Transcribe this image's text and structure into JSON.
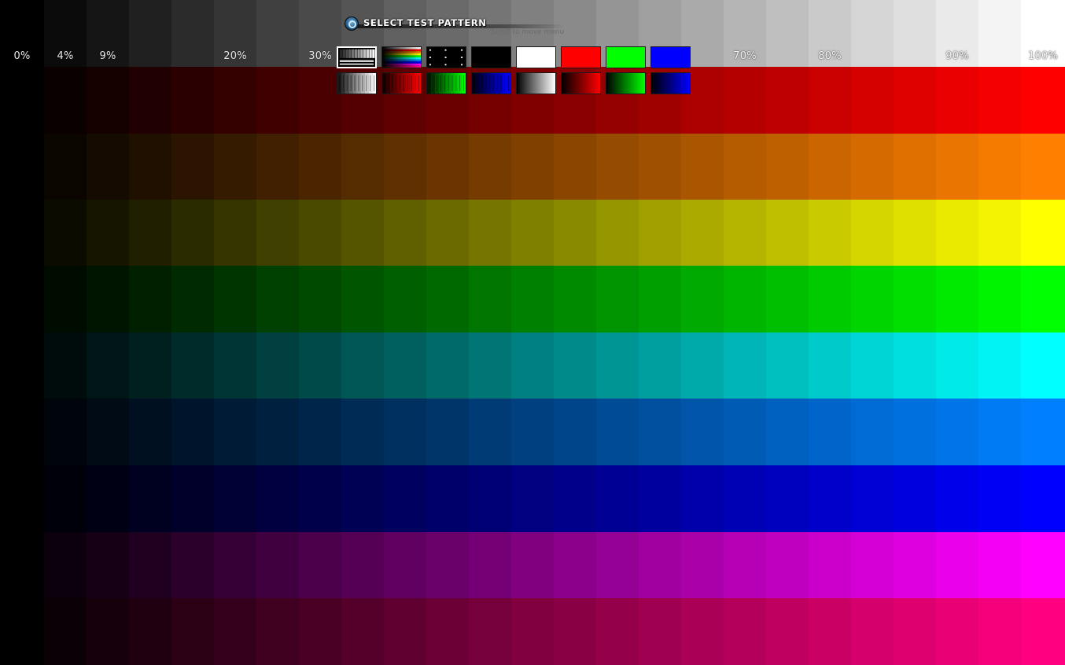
{
  "menu": {
    "title": "SELECT TEST PATTERN",
    "hint": "Scroll to move menu",
    "icon": "test-pattern-icon",
    "selected_index": 0,
    "thumbnails": [
      {
        "name": "grayscale-steps",
        "kind": "gray-steps"
      },
      {
        "name": "color-bars",
        "kind": "color-bars"
      },
      {
        "name": "dots",
        "kind": "dots"
      },
      {
        "name": "black",
        "kind": "solid",
        "color": "#000000"
      },
      {
        "name": "white",
        "kind": "solid",
        "color": "#ffffff"
      },
      {
        "name": "red",
        "kind": "solid",
        "color": "#ff0000"
      },
      {
        "name": "green",
        "kind": "solid",
        "color": "#00ff00"
      },
      {
        "name": "blue",
        "kind": "solid",
        "color": "#0000ff"
      },
      {
        "name": "gray-ramp-steps",
        "kind": "ramp-steps",
        "color": "#ffffff"
      },
      {
        "name": "red-ramp-steps",
        "kind": "ramp-steps",
        "color": "#ff0000"
      },
      {
        "name": "green-ramp-steps",
        "kind": "ramp-steps",
        "color": "#00ff00"
      },
      {
        "name": "blue-ramp-steps",
        "kind": "ramp-steps",
        "color": "#0000ff"
      },
      {
        "name": "gray-gradient",
        "kind": "gradient",
        "color": "#ffffff"
      },
      {
        "name": "red-gradient",
        "kind": "gradient",
        "color": "#ff0000"
      },
      {
        "name": "green-gradient",
        "kind": "gradient",
        "color": "#00ff00"
      },
      {
        "name": "blue-gradient",
        "kind": "gradient",
        "color": "#0000ff"
      }
    ]
  },
  "pattern": {
    "levels_percent": [
      0,
      4,
      9,
      14,
      20,
      25,
      30,
      35,
      40,
      45,
      50,
      55,
      60,
      65,
      70,
      75,
      80,
      85,
      90,
      95,
      100
    ],
    "row_colors": [
      "#ffffff",
      "#ff0000",
      "#ff8000",
      "#ffff00",
      "#00ff00",
      "#00ffff",
      "#0080ff",
      "#0000ff",
      "#ff00ff",
      "#ff0080"
    ],
    "labels": [
      {
        "text": "0%",
        "level_index": 0
      },
      {
        "text": "4%",
        "level_index": 1
      },
      {
        "text": "9%",
        "level_index": 2
      },
      {
        "text": "20%",
        "level_index": 5
      },
      {
        "text": "30%",
        "level_index": 7
      },
      {
        "text": "70%",
        "level_index": 17
      },
      {
        "text": "80%",
        "level_index": 19
      },
      {
        "text": "90%",
        "level_index": 22
      },
      {
        "text": "100%",
        "level_index": 24
      }
    ]
  }
}
